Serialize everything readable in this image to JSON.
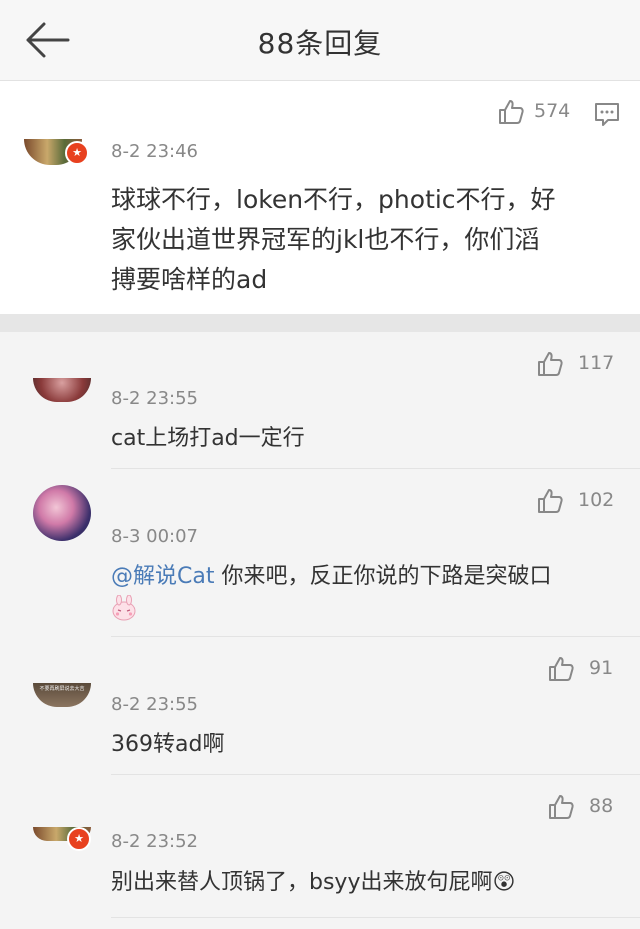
{
  "header": {
    "title": "88条回复"
  },
  "main_comment": {
    "time": "8-2 23:46",
    "likes": "574",
    "text_line1": "球球不行，loken不行，photic不行，好",
    "text_line2": "家伙出道世界冠军的jkl也不行，你们滔",
    "text_line3": "搏要啥样的ad"
  },
  "replies": [
    {
      "time": "8-2 23:55",
      "likes": "117",
      "text": "cat上场打ad一定行"
    },
    {
      "time": "8-3 00:07",
      "likes": "102",
      "mention": "@解说Cat",
      "text": " 你来吧，反正你说的下路是突破口"
    },
    {
      "time": "8-2 23:55",
      "likes": "91",
      "text": "369转ad啊",
      "avatar_text": "不要再刷屏说去大吉"
    },
    {
      "time": "8-2 23:52",
      "likes": "88",
      "text": "别出来替人顶锅了，bsyy出来放句屁啊😲"
    }
  ],
  "colors": {
    "accent_badge": "#e8411f",
    "mention": "#4a7bb7"
  },
  "icons": [
    "back-arrow-icon",
    "thumb-up-icon",
    "comment-icon",
    "verified-badge-icon",
    "bunny-emoji-icon",
    "shocked-emoji-icon"
  ]
}
